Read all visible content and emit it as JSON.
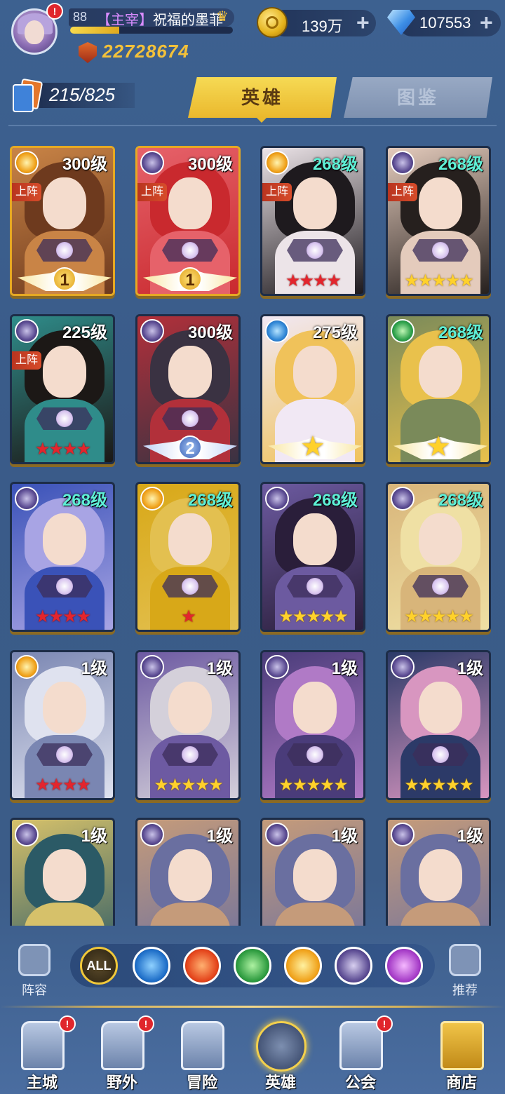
{
  "player": {
    "level": "88",
    "role_tag": "【主宰】",
    "name": "祝福的墨菲",
    "xp_progress": 0.3,
    "power": "22728674",
    "avatar_badge": "!"
  },
  "resources": {
    "gold": "139万",
    "diamonds": "107553",
    "plus_symbol": "+"
  },
  "hero_count": "215/825",
  "tabs": {
    "heroes": "英雄",
    "atlas": "图鉴"
  },
  "labels": {
    "deploy": "上阵"
  },
  "heroes": [
    {
      "level": "300级",
      "faction": "light",
      "deployed": true,
      "frame": "gold",
      "bottom": "wings",
      "rank": "1",
      "palette": [
        "#6e3a1e",
        "#c98446"
      ]
    },
    {
      "level": "300级",
      "faction": "dark",
      "deployed": true,
      "frame": "gold",
      "bottom": "wings",
      "rank": "1",
      "palette": [
        "#c9292e",
        "#e6626a"
      ]
    },
    {
      "level": "268级",
      "faction": "light",
      "deployed": true,
      "frame": "plain",
      "bottom": "stars",
      "stars": "★★★★",
      "star_color": "red",
      "palette": [
        "#1e1a1e",
        "#ece4e8"
      ]
    },
    {
      "level": "268级",
      "faction": "dark",
      "deployed": true,
      "frame": "plain",
      "bottom": "stars",
      "stars": "★★★★★",
      "star_color": "gold",
      "palette": [
        "#26201e",
        "#e4cbbc"
      ]
    },
    {
      "level": "225级",
      "faction": "dark",
      "deployed": true,
      "frame": "plain",
      "bottom": "stars",
      "stars": "★★★★",
      "star_color": "red",
      "palette": [
        "#1c1816",
        "#2f8c8a"
      ]
    },
    {
      "level": "300级",
      "faction": "dark",
      "deployed": false,
      "frame": "plain",
      "bottom": "wings-blue",
      "rank": "2",
      "palette": [
        "#3a3242",
        "#b2303a"
      ]
    },
    {
      "level": "275级",
      "faction": "water",
      "deployed": false,
      "frame": "plain",
      "bottom": "bigstar",
      "palette": [
        "#f0c25a",
        "#f1e8f4"
      ]
    },
    {
      "level": "268级",
      "faction": "wind",
      "deployed": false,
      "frame": "plain",
      "bottom": "bigstar",
      "palette": [
        "#e9c14c",
        "#7a8a5a"
      ]
    },
    {
      "level": "268级",
      "faction": "dark",
      "deployed": false,
      "frame": "plain",
      "bottom": "stars",
      "stars": "★★★★",
      "star_color": "red",
      "palette": [
        "#a8a4e4",
        "#3a52b8"
      ]
    },
    {
      "level": "268级",
      "faction": "light",
      "deployed": false,
      "frame": "plain",
      "bottom": "stars",
      "stars": "★",
      "star_color": "red",
      "palette": [
        "#e3c050",
        "#d8a818"
      ]
    },
    {
      "level": "268级",
      "faction": "dark",
      "deployed": false,
      "frame": "plain",
      "bottom": "stars",
      "stars": "★★★★★",
      "star_color": "gold",
      "palette": [
        "#2a1e3a",
        "#6c5aa0"
      ]
    },
    {
      "level": "268级",
      "faction": "dark",
      "deployed": false,
      "frame": "plain",
      "bottom": "stars",
      "stars": "★★★★★",
      "star_color": "gold",
      "palette": [
        "#efe0a4",
        "#d8b57a"
      ]
    },
    {
      "level": "1级",
      "faction": "light",
      "deployed": false,
      "frame": "plain",
      "bottom": "stars",
      "stars": "★★★★",
      "star_color": "red",
      "palette": [
        "#dfe2ef",
        "#7a86b2"
      ]
    },
    {
      "level": "1级",
      "faction": "dark",
      "deployed": false,
      "frame": "plain",
      "bottom": "stars",
      "stars": "★★★★★",
      "star_color": "gold",
      "palette": [
        "#d4d0da",
        "#6d5aa2"
      ]
    },
    {
      "level": "1级",
      "faction": "dark",
      "deployed": false,
      "frame": "plain",
      "bottom": "stars",
      "stars": "★★★★★",
      "star_color": "gold",
      "palette": [
        "#b07ac6",
        "#4a3c7a"
      ]
    },
    {
      "level": "1级",
      "faction": "dark",
      "deployed": false,
      "frame": "plain",
      "bottom": "stars",
      "stars": "★★★★★",
      "star_color": "gold",
      "palette": [
        "#d896c0",
        "#2c3a68"
      ]
    },
    {
      "level": "1级",
      "faction": "dark",
      "deployed": false,
      "frame": "plain",
      "bottom": "none",
      "palette": [
        "#2b5a66",
        "#d6c16a"
      ]
    },
    {
      "level": "1级",
      "faction": "dark",
      "deployed": false,
      "frame": "plain",
      "bottom": "none",
      "palette": [
        "#6a6fa0",
        "#c59b7a"
      ]
    },
    {
      "level": "1级",
      "faction": "dark",
      "deployed": false,
      "frame": "plain",
      "bottom": "none",
      "palette": [
        "#6a6fa0",
        "#c59b7a"
      ]
    },
    {
      "level": "1级",
      "faction": "dark",
      "deployed": false,
      "frame": "plain",
      "bottom": "none",
      "palette": [
        "#6a6fa0",
        "#c59b7a"
      ]
    }
  ],
  "filter_bar": {
    "left_label": "阵容",
    "right_label": "推荐",
    "all_label": "ALL",
    "factions": [
      "water-icon",
      "fire-icon",
      "wind-icon",
      "light-icon",
      "dark-icon",
      "arcane-icon"
    ]
  },
  "nav": {
    "city": "主城",
    "wild": "野外",
    "adventure": "冒险",
    "heroes": "英雄",
    "guild": "公会",
    "shop": "商店",
    "alert": "!"
  }
}
